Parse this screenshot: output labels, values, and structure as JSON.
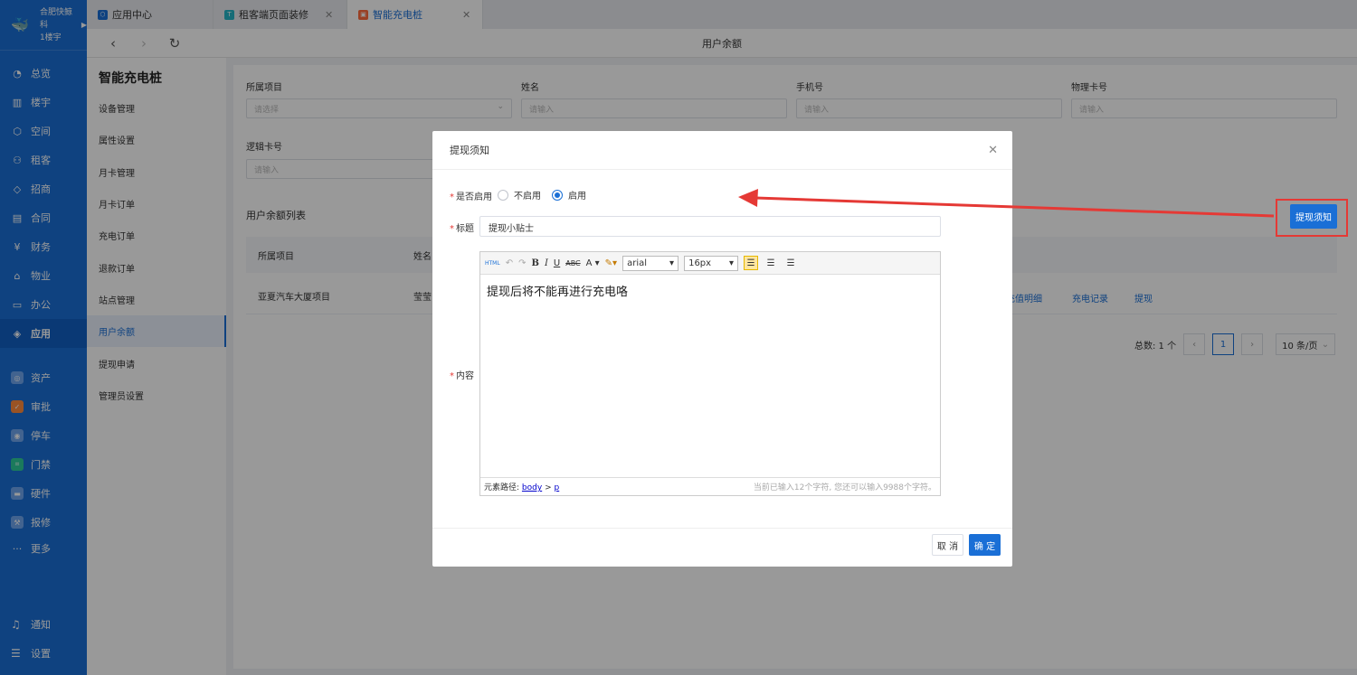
{
  "sidebar": {
    "brand_name": "合肥快鲸科",
    "brand_sub": "1楼宇",
    "items": [
      {
        "label": "总览",
        "icon": "dashboard-icon"
      },
      {
        "label": "楼宇",
        "icon": "building-icon"
      },
      {
        "label": "空间",
        "icon": "cube-icon"
      },
      {
        "label": "租客",
        "icon": "users-icon"
      },
      {
        "label": "招商",
        "icon": "tag-icon"
      },
      {
        "label": "合同",
        "icon": "document-icon"
      },
      {
        "label": "财务",
        "icon": "yen-icon"
      },
      {
        "label": "物业",
        "icon": "home-icon"
      },
      {
        "label": "办公",
        "icon": "monitor-icon"
      },
      {
        "label": "应用",
        "icon": "apps-icon"
      }
    ],
    "apps": [
      {
        "label": "资产",
        "color": "#6ea5ee"
      },
      {
        "label": "审批",
        "color": "#ff8a3d"
      },
      {
        "label": "停车",
        "color": "#6ea5ee"
      },
      {
        "label": "门禁",
        "color": "#2ecc9a"
      },
      {
        "label": "硬件",
        "color": "#6ea5ee"
      },
      {
        "label": "报修",
        "color": "#6ea5ee"
      }
    ],
    "more": "更多",
    "notify": "通知",
    "settings": "设置"
  },
  "tabs": [
    {
      "label": "应用中心",
      "color": "#1a6fd6",
      "closable": false
    },
    {
      "label": "租客端页面装修",
      "color": "#26b5c7",
      "closable": true
    },
    {
      "label": "智能充电桩",
      "color": "#ff6b3d",
      "closable": true
    }
  ],
  "toolbar": {
    "title": "用户余额"
  },
  "subnav": {
    "title": "智能充电桩",
    "items": [
      "设备管理",
      "属性设置",
      "月卡管理",
      "月卡订单",
      "充电订单",
      "退款订单",
      "站点管理",
      "用户余额",
      "提现申请",
      "管理员设置"
    ]
  },
  "filters": {
    "project_label": "所属项目",
    "project_placeholder": "请选择",
    "name_label": "姓名",
    "name_placeholder": "请输入",
    "phone_label": "手机号",
    "phone_placeholder": "请输入",
    "card_label": "物理卡号",
    "card_placeholder": "请输入",
    "logic_label": "逻辑卡号",
    "logic_placeholder": "请输入"
  },
  "list": {
    "title": "用户余额列表",
    "notice_button": "提现须知",
    "headers": [
      "所属项目",
      "姓名"
    ],
    "row": {
      "project": "亚夏汽车大厦项目",
      "name": "莹莹"
    },
    "actions": [
      "充值明细",
      "充电记录",
      "提现"
    ],
    "total": "总数: 1 个",
    "page": "1",
    "page_size": "10 条/页"
  },
  "dialog": {
    "title": "提现须知",
    "enable_label": "是否启用",
    "opt_off": "不启用",
    "opt_on": "启用",
    "title_label": "标题",
    "title_value": "提现小贴士",
    "content_label": "内容",
    "content": "提现后将不能再进行充电咯",
    "font_family": "arial",
    "font_size": "16px",
    "path_label": "元素路径:",
    "path_body": "body",
    "path_sep": ">",
    "path_p": "p",
    "char_count": "当前已输入12个字符, 您还可以输入9988个字符。",
    "cancel": "取 消",
    "ok": "确 定"
  },
  "colors": {
    "primary": "#1a6fd6",
    "annotation": "#e53935"
  }
}
